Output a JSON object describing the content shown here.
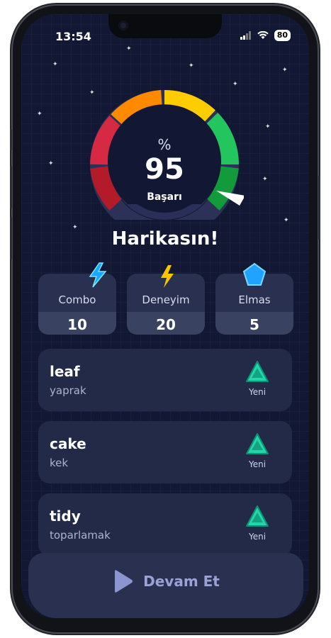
{
  "status": {
    "time": "13:54",
    "battery": "80"
  },
  "gauge": {
    "percent_symbol": "%",
    "value": "95",
    "label": "Başarı"
  },
  "headline": "Harikasın!",
  "stats": [
    {
      "label": "Combo",
      "value": "10",
      "icon": "combo-bolt-icon"
    },
    {
      "label": "Deneyim",
      "value": "20",
      "icon": "lightning-icon"
    },
    {
      "label": "Elmas",
      "value": "5",
      "icon": "gem-icon"
    }
  ],
  "words": [
    {
      "word": "leaf",
      "meaning": "yaprak",
      "badge": "Yeni"
    },
    {
      "word": "cake",
      "meaning": "kek",
      "badge": "Yeni"
    },
    {
      "word": "tidy",
      "meaning": "toparlamak",
      "badge": "Yeni"
    }
  ],
  "footer": {
    "continue_label": "Devam Et"
  },
  "colors": {
    "background": "#121833",
    "card": "#232a47",
    "accent_green": "#1fd7a8",
    "continue_text": "#9aa3d6"
  }
}
